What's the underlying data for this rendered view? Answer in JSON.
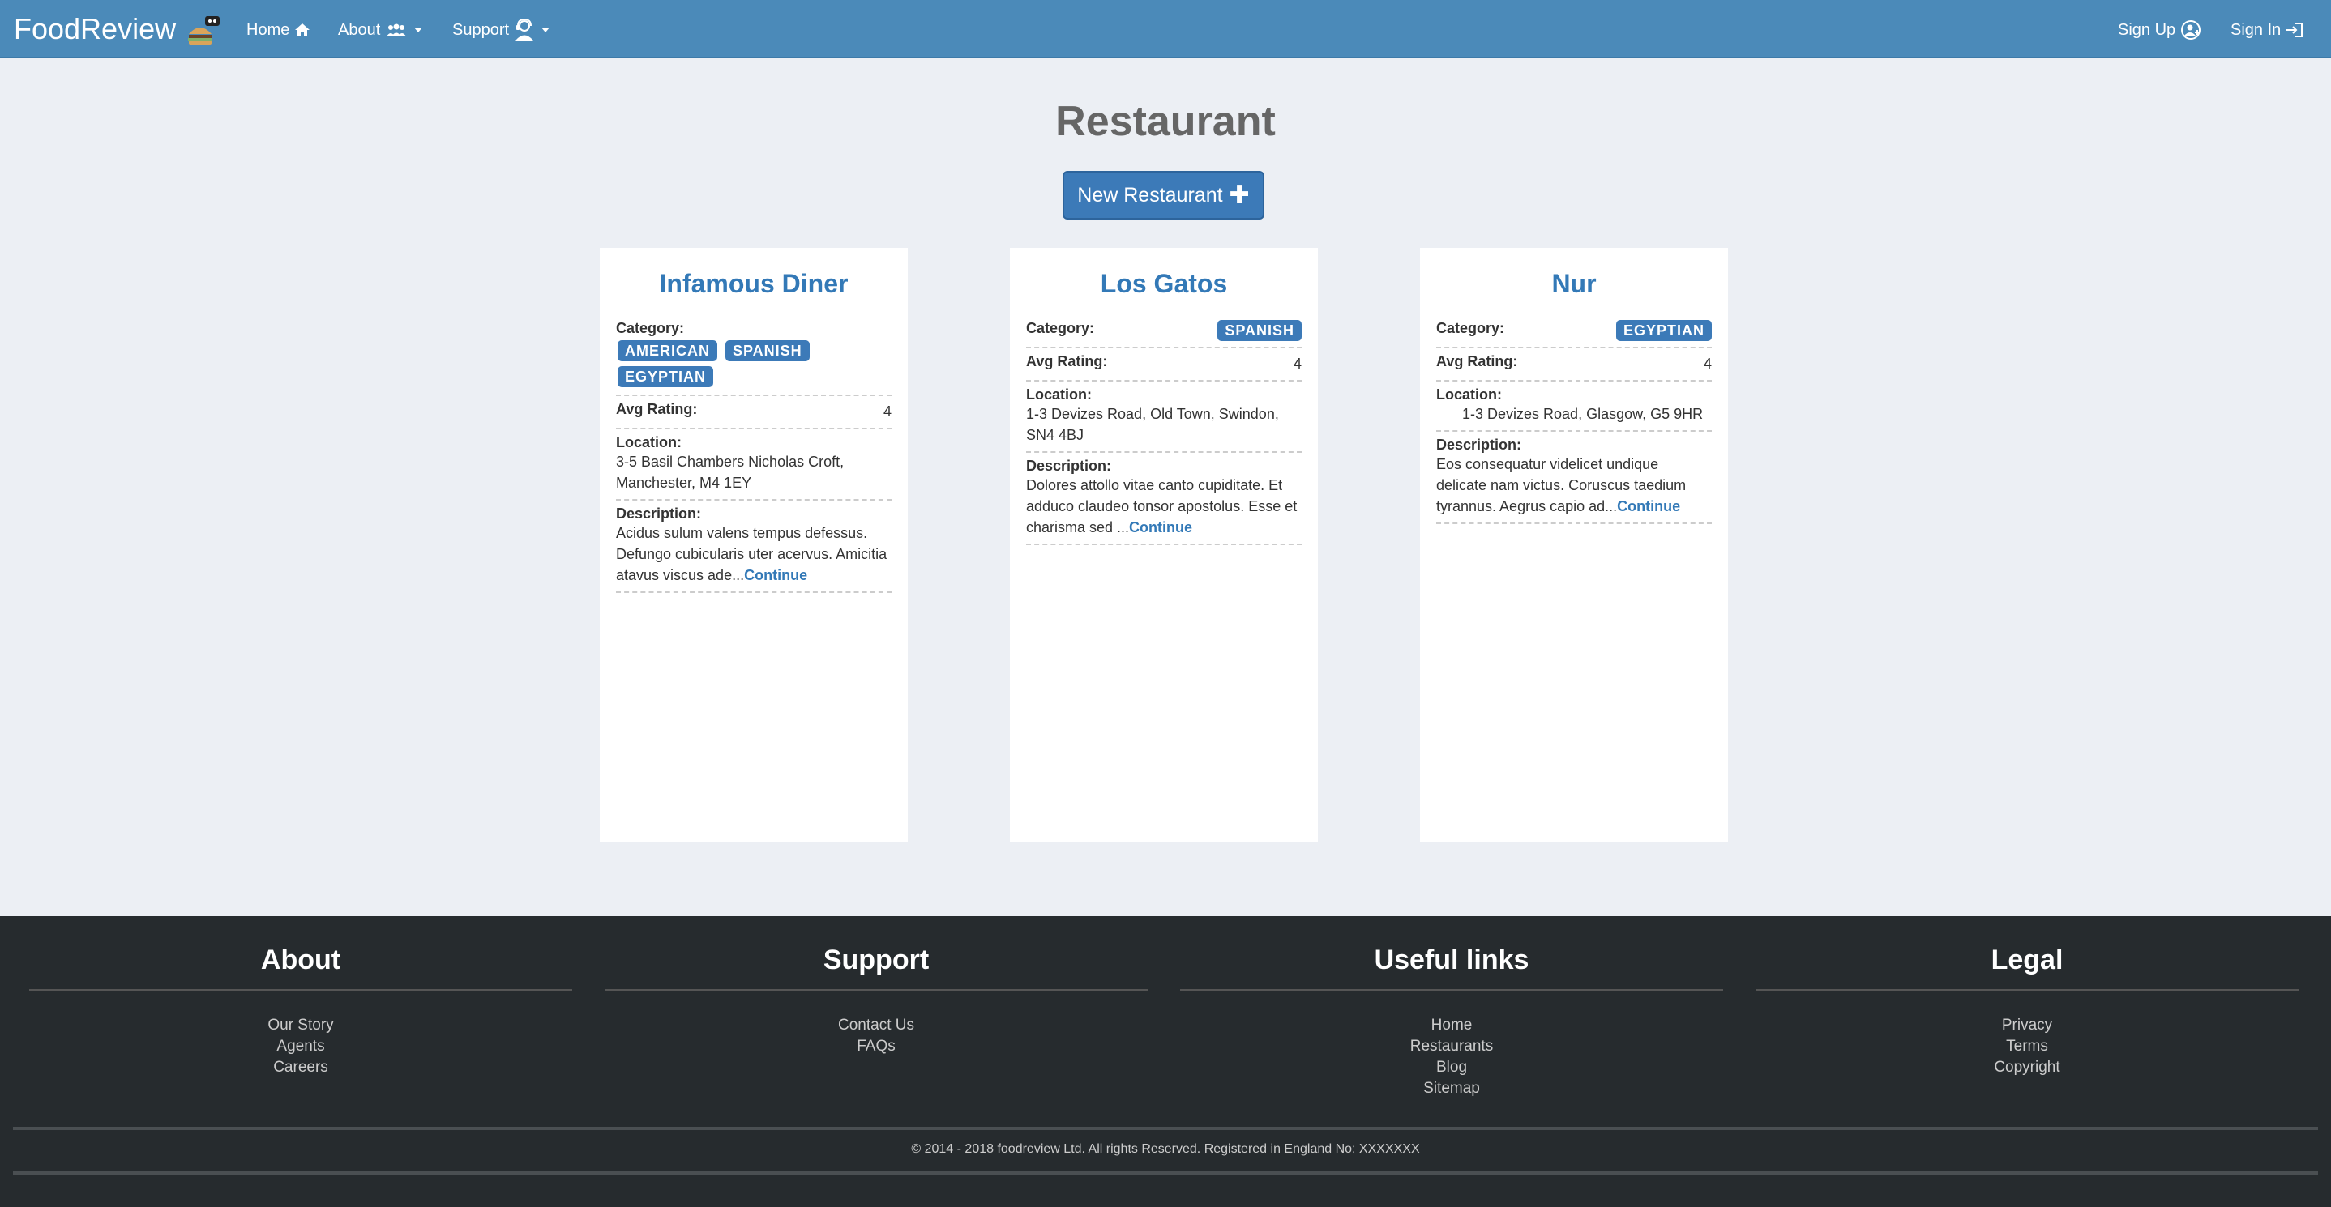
{
  "navbar": {
    "brand": "FoodReview",
    "home": "Home",
    "about": "About",
    "support": "Support",
    "signup": "Sign Up",
    "signin": "Sign In",
    "colors": {
      "background": "#4b8ab9",
      "text": "#ffffff"
    }
  },
  "main": {
    "title": "Restaurant",
    "new_button": "New Restaurant",
    "labels": {
      "category": "Category:",
      "avg_rating": "Avg Rating:",
      "location": "Location:",
      "description": "Description:",
      "continue": "Continue"
    },
    "restaurants": [
      {
        "name": "Infamous Diner",
        "categories": [
          "AMERICAN",
          "SPANISH",
          "EGYPTIAN"
        ],
        "rating": "4",
        "location": "3-5 Basil Chambers Nicholas Croft, Manchester, M4 1EY",
        "description": "Acidus sulum valens tempus defessus. Defungo cubicularis uter acervus. Amicitia atavus viscus ade..."
      },
      {
        "name": "Los Gatos",
        "categories": [
          "SPANISH"
        ],
        "rating": "4",
        "location": "1-3 Devizes Road, Old Town, Swindon, SN4 4BJ",
        "description": "Dolores attollo vitae canto cupiditate. Et adduco claudeo tonsor apostolus. Esse et charisma sed ..."
      },
      {
        "name": "Nur",
        "categories": [
          "EGYPTIAN"
        ],
        "rating": "4",
        "location": "1-3 Devizes Road, Glasgow, G5 9HR",
        "description": "Eos consequatur videlicet undique delicate nam victus. Coruscus taedium tyrannus. Aegrus capio ad..."
      }
    ],
    "colors": {
      "accent": "#3c7ab8",
      "page_bg": "#eceff4"
    }
  },
  "footer": {
    "about": {
      "title": "About",
      "links": [
        "Our Story",
        "Agents",
        "Careers"
      ]
    },
    "support": {
      "title": "Support",
      "links": [
        "Contact Us",
        "FAQs"
      ]
    },
    "useful": {
      "title": "Useful links",
      "links": [
        "Home",
        "Restaurants",
        "Blog",
        "Sitemap"
      ]
    },
    "legal": {
      "title": "Legal",
      "links": [
        "Privacy",
        "Terms",
        "Copyright"
      ]
    },
    "copyright": "© 2014 - 2018 foodreview Ltd. All rights Reserved. Registered in England No: XXXXXXX",
    "colors": {
      "background": "#262b2e"
    }
  }
}
